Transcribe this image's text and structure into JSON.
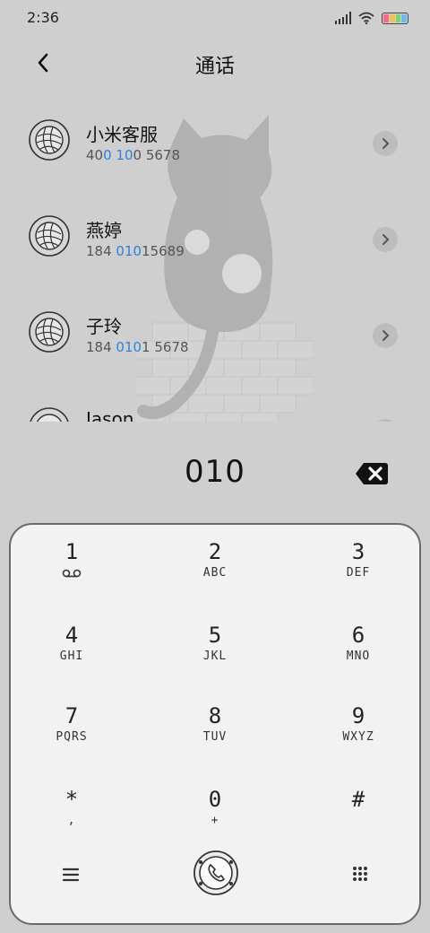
{
  "status": {
    "time": "2:36"
  },
  "header": {
    "title": "通话"
  },
  "contacts": [
    {
      "name": "小米客服",
      "num_parts": [
        {
          "t": "40",
          "hl": false
        },
        {
          "t": "0",
          "hl": true
        },
        {
          "t": " ",
          "hl": false
        },
        {
          "t": "10",
          "hl": true
        },
        {
          "t": "0 5678",
          "hl": false
        }
      ]
    },
    {
      "name": "燕婷",
      "num_parts": [
        {
          "t": "184 ",
          "hl": false
        },
        {
          "t": "010",
          "hl": true
        },
        {
          "t": "15689",
          "hl": false
        }
      ]
    },
    {
      "name": "子玲",
      "num_parts": [
        {
          "t": "184 ",
          "hl": false
        },
        {
          "t": "010",
          "hl": true
        },
        {
          "t": "1 5678",
          "hl": false
        }
      ]
    },
    {
      "name": "Jason",
      "num_parts": []
    }
  ],
  "dialer": {
    "number": "010"
  },
  "keypad": {
    "keys": [
      {
        "digit": "1",
        "letters": ""
      },
      {
        "digit": "2",
        "letters": "ABC"
      },
      {
        "digit": "3",
        "letters": "DEF"
      },
      {
        "digit": "4",
        "letters": "GHI"
      },
      {
        "digit": "5",
        "letters": "JKL"
      },
      {
        "digit": "6",
        "letters": "MNO"
      },
      {
        "digit": "7",
        "letters": "PQRS"
      },
      {
        "digit": "8",
        "letters": "TUV"
      },
      {
        "digit": "9",
        "letters": "WXYZ"
      },
      {
        "digit": "*",
        "letters": ","
      },
      {
        "digit": "0",
        "letters": "+"
      },
      {
        "digit": "#",
        "letters": ""
      }
    ]
  },
  "icons": {
    "back": "chevron-left-icon",
    "delete": "backspace-icon",
    "menu": "menu-icon",
    "call": "phone-icon",
    "dialpad": "dialpad-icon",
    "voicemail": "voicemail-icon"
  },
  "colors": {
    "highlight": "#2a83e0",
    "background": "#cfcfcf",
    "keypad": "#f2f2f2"
  }
}
